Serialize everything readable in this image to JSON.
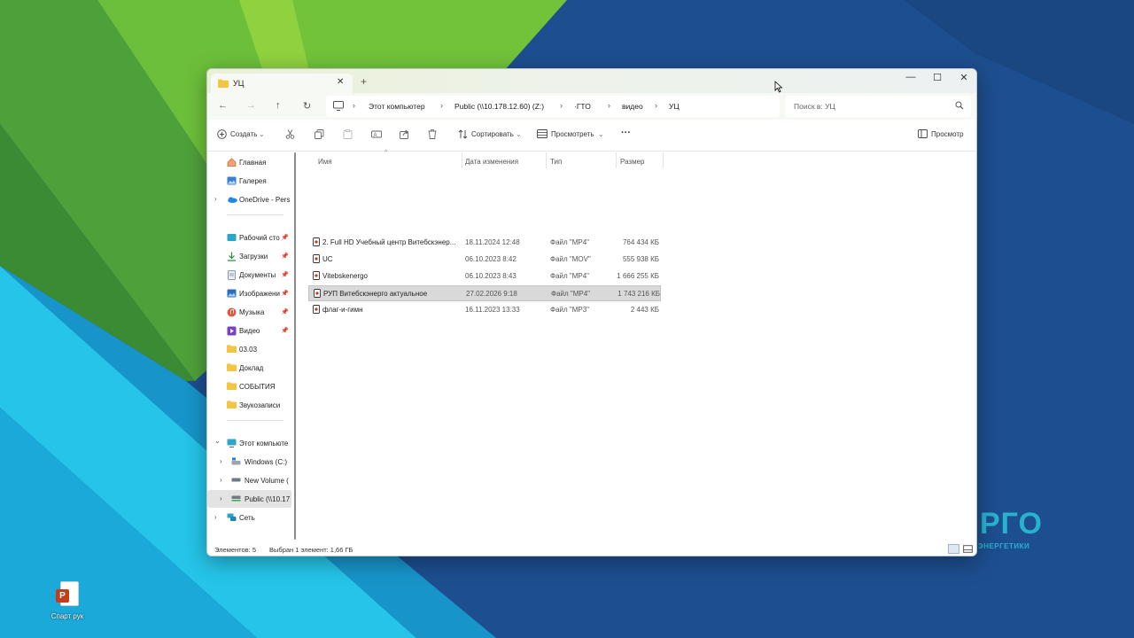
{
  "desktop": {
    "brand_text": "РГО",
    "brand_sub": "ЭНЕРГЕТИКИ",
    "icons": [
      {
        "label": "Спарт рук",
        "icon": "powerpoint-file-icon"
      }
    ]
  },
  "window": {
    "tab_title": "УЦ",
    "tab_close": "✕",
    "new_tab": "+",
    "controls": {
      "minimize": "—",
      "maximize": "☐",
      "close": "✕"
    }
  },
  "nav": {
    "back": "←",
    "forward": "→",
    "up": "↑",
    "refresh": "↻",
    "breadcrumb": [
      "Этот компьютер",
      "Public (\\\\10.178.12.60) (Z:)",
      "·ГТО",
      "видео",
      "УЦ"
    ],
    "separator": "›",
    "search_placeholder": "Поиск в: УЦ"
  },
  "toolbar": {
    "create": "Создать",
    "sort": "Сортировать",
    "view": "Просмотреть",
    "more": "···",
    "preview": "Просмотр"
  },
  "sidebar": {
    "items": [
      {
        "label": "Главная",
        "icon": "home-icon"
      },
      {
        "label": "Галерея",
        "icon": "gallery-icon"
      },
      {
        "label": "OneDrive - Pers",
        "icon": "onedrive-icon"
      },
      {
        "label": "Рабочий сто",
        "icon": "desktop-icon",
        "pinned": true
      },
      {
        "label": "Загрузки",
        "icon": "download-icon",
        "pinned": true
      },
      {
        "label": "Документы",
        "icon": "documents-icon",
        "pinned": true
      },
      {
        "label": "Изображени",
        "icon": "pictures-icon",
        "pinned": true
      },
      {
        "label": "Музыка",
        "icon": "music-icon",
        "pinned": true
      },
      {
        "label": "Видео",
        "icon": "video-icon",
        "pinned": true
      },
      {
        "label": "03.03",
        "icon": "folder-icon"
      },
      {
        "label": "Доклад",
        "icon": "folder-icon"
      },
      {
        "label": "СОБЫТИЯ",
        "icon": "folder-icon"
      },
      {
        "label": "Звукозаписи",
        "icon": "folder-icon"
      },
      {
        "label": "Этот компьюте",
        "icon": "computer-icon"
      },
      {
        "label": "Windows (C:)",
        "icon": "drive-icon"
      },
      {
        "label": "New Volume (",
        "icon": "drive-icon"
      },
      {
        "label": "Public (\\\\10.17",
        "icon": "network-drive-icon"
      },
      {
        "label": "Сеть",
        "icon": "network-icon"
      }
    ],
    "pin_glyph": "📌",
    "chevron_right": "›",
    "chevron_down": "⌄"
  },
  "filelist": {
    "columns": [
      "Имя",
      "Дата изменения",
      "Тип",
      "Размер"
    ],
    "sort_indicator": "^",
    "rows": [
      {
        "name": "2. Full HD Учебный центр Витебскэнер...",
        "date": "18.11.2024 12:48",
        "type": "Файл \"MP4\"",
        "size": "764 434 КБ"
      },
      {
        "name": "UC",
        "date": "06.10.2023 8:42",
        "type": "Файл \"MOV\"",
        "size": "555 938 КБ"
      },
      {
        "name": "Vitebskenergo",
        "date": "06.10.2023 8:43",
        "type": "Файл \"MP4\"",
        "size": "1 666 255 КБ"
      },
      {
        "name": "РУП Витебскэнерго актуальное",
        "date": "27.02.2026 9:18",
        "type": "Файл \"MP4\"",
        "size": "1 743 216 КБ",
        "selected": true
      },
      {
        "name": "флаг-и-гимн",
        "date": "16.11.2023 13:33",
        "type": "Файл \"MP3\"",
        "size": "2 443 КБ"
      }
    ]
  },
  "status": {
    "items_count": "Элементов: 5",
    "selection": "Выбран 1 элемент: 1,66 ГБ"
  },
  "colors": {
    "wallpaper_blue": "#1d4e8f",
    "wallpaper_green": "#5fae35",
    "wallpaper_cyan": "#25c4e8",
    "folder_yellow": "#f4c542",
    "accent": "#0067c0"
  }
}
